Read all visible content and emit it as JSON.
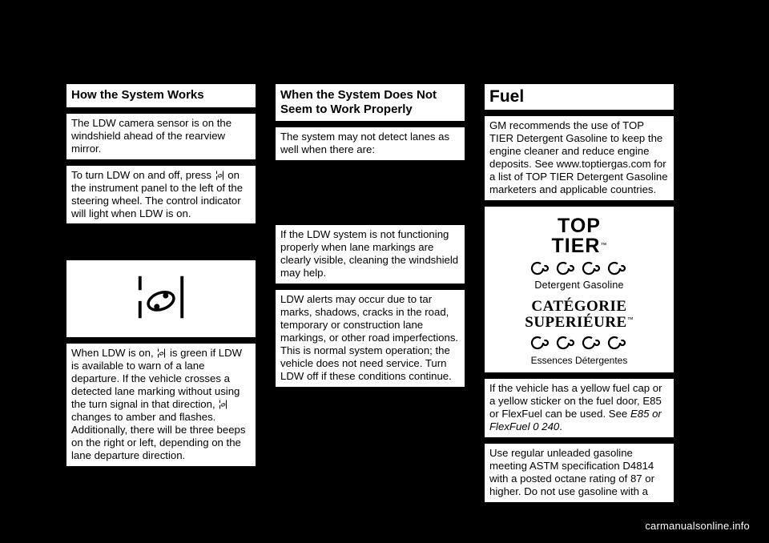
{
  "page": {
    "background_color": "#000000",
    "footer_text": "carmanualsonline.info"
  },
  "columns": [
    {
      "id": "column-1",
      "blocks": [
        {
          "type": "heading",
          "text": "How the System Works"
        },
        {
          "type": "text",
          "text": "The LDW camera sensor is on the windshield ahead of the rearview mirror."
        },
        {
          "type": "text_with_icon",
          "text_before": "To turn LDW on and off, press ",
          "icon": "ldw-lane-departure-icon",
          "text_after": " on the instrument panel to the left of the steering wheel. The control indicator will light when LDW is on."
        },
        {
          "type": "image",
          "icon": "ldw-lane-departure-large-icon"
        },
        {
          "type": "text_with_icons",
          "segments": [
            {
              "text": "When LDW is on, "
            },
            {
              "icon": "ldw-lane-departure-icon"
            },
            {
              "text": " is green if LDW is available to warn of a lane departure. If the vehicle crosses a detected lane marking without using the turn signal in that direction, "
            },
            {
              "icon": "ldw-lane-departure-icon"
            },
            {
              "text": " changes to amber and flashes. Additionally, there will be three beeps on the right or left, depending on the lane departure direction."
            }
          ]
        }
      ]
    },
    {
      "id": "column-2",
      "blocks": [
        {
          "type": "heading",
          "text": "When the System Does Not Seem to Work Properly"
        },
        {
          "type": "text",
          "text": "The system may not detect lanes as well when there are:"
        },
        {
          "type": "text",
          "text": "If the LDW system is not functioning properly when lane markings are clearly visible, cleaning the windshield may help."
        },
        {
          "type": "text",
          "text": "LDW alerts may occur due to tar marks, shadows, cracks in the road, temporary or construction lane markings, or other road imperfections. This is normal system operation; the vehicle does not need service. Turn LDW off if these conditions continue."
        }
      ]
    },
    {
      "id": "column-3",
      "blocks": [
        {
          "type": "heading_big",
          "text": "Fuel"
        },
        {
          "type": "text",
          "text": "GM recommends the use of TOP TIER Detergent Gasoline to keep the engine cleaner and reduce engine deposits. See www.toptiergas.com for a list of TOP TIER Detergent Gasoline marketers and applicable countries."
        },
        {
          "type": "logo",
          "logo": {
            "top_word": "TOP",
            "tier_word": "TIER",
            "tier_tm": "™",
            "subtitle": "Detergent Gasoline",
            "categorie_word": "CATÉGORIE",
            "superieure_word": "SUPERIÉURE",
            "superieure_tm": "™",
            "categorie_sub": "Essences Détergentes"
          }
        },
        {
          "type": "text_italic_ref",
          "text_before": "If the vehicle has a yellow fuel cap or a yellow sticker on the fuel door, E85 or FlexFuel can be used. See ",
          "italic_text": "E85 or FlexFuel 0 240",
          "text_after": "."
        },
        {
          "type": "text",
          "text": "Use regular unleaded gasoline meeting ASTM specification D4814 with a posted octane rating of 87 or higher. Do not use gasoline with a"
        }
      ]
    }
  ]
}
